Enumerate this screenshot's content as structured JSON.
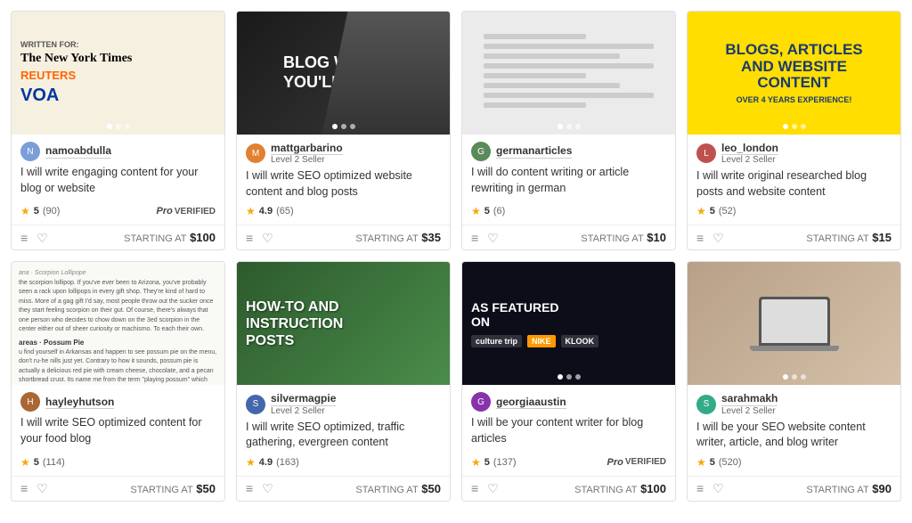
{
  "cards": [
    {
      "id": "card-1",
      "seller": "namoabdulla",
      "seller_level": null,
      "title": "I will write engaging content for your blog or website",
      "rating": "5",
      "count": "(90)",
      "pro_verified": true,
      "price": "$100",
      "image_type": "img-1",
      "avatar_letter": "N"
    },
    {
      "id": "card-2",
      "seller": "mattgarbarino",
      "seller_level": "Level 2 Seller",
      "title": "I will write SEO optimized website content and blog posts",
      "rating": "4.9",
      "count": "(65)",
      "pro_verified": false,
      "price": "$35",
      "image_type": "img-2",
      "avatar_letter": "M"
    },
    {
      "id": "card-3",
      "seller": "germanarticles",
      "seller_level": null,
      "title": "I will do content writing or article rewriting in german",
      "rating": "5",
      "count": "(6)",
      "pro_verified": false,
      "price": "$10",
      "image_type": "img-3",
      "avatar_letter": "G"
    },
    {
      "id": "card-4",
      "seller": "leo_london",
      "seller_level": "Level 2 Seller",
      "title": "I will write original researched blog posts and website content",
      "rating": "5",
      "count": "(52)",
      "pro_verified": false,
      "price": "$15",
      "image_type": "img-4",
      "avatar_letter": "L"
    },
    {
      "id": "card-5",
      "seller": "hayleyhutson",
      "seller_level": null,
      "title": "I will write SEO optimized content for your food blog",
      "rating": "5",
      "count": "(114)",
      "pro_verified": false,
      "price": "$50",
      "image_type": "img-5",
      "avatar_letter": "H"
    },
    {
      "id": "card-6",
      "seller": "silvermagpie",
      "seller_level": "Level 2 Seller",
      "title": "I will write SEO optimized, traffic gathering, evergreen content",
      "rating": "4.9",
      "count": "(163)",
      "pro_verified": false,
      "price": "$50",
      "image_type": "img-6",
      "avatar_letter": "S"
    },
    {
      "id": "card-7",
      "seller": "georgiaaustin",
      "seller_level": null,
      "title": "I will be your content writer for blog articles",
      "rating": "5",
      "count": "(137)",
      "pro_verified": true,
      "price": "$100",
      "image_type": "img-7",
      "avatar_letter": "G"
    },
    {
      "id": "card-8",
      "seller": "sarahmakh",
      "seller_level": "Level 2 Seller",
      "title": "I will be your SEO website content writer, article, and blog writer",
      "rating": "5",
      "count": "(520)",
      "pro_verified": false,
      "price": "$90",
      "image_type": "img-8",
      "avatar_letter": "S"
    }
  ],
  "labels": {
    "starting_at": "STARTING AT",
    "pro_text": "Pro",
    "verified_text": "VERIFIED",
    "level2": "Level 2 Seller"
  }
}
